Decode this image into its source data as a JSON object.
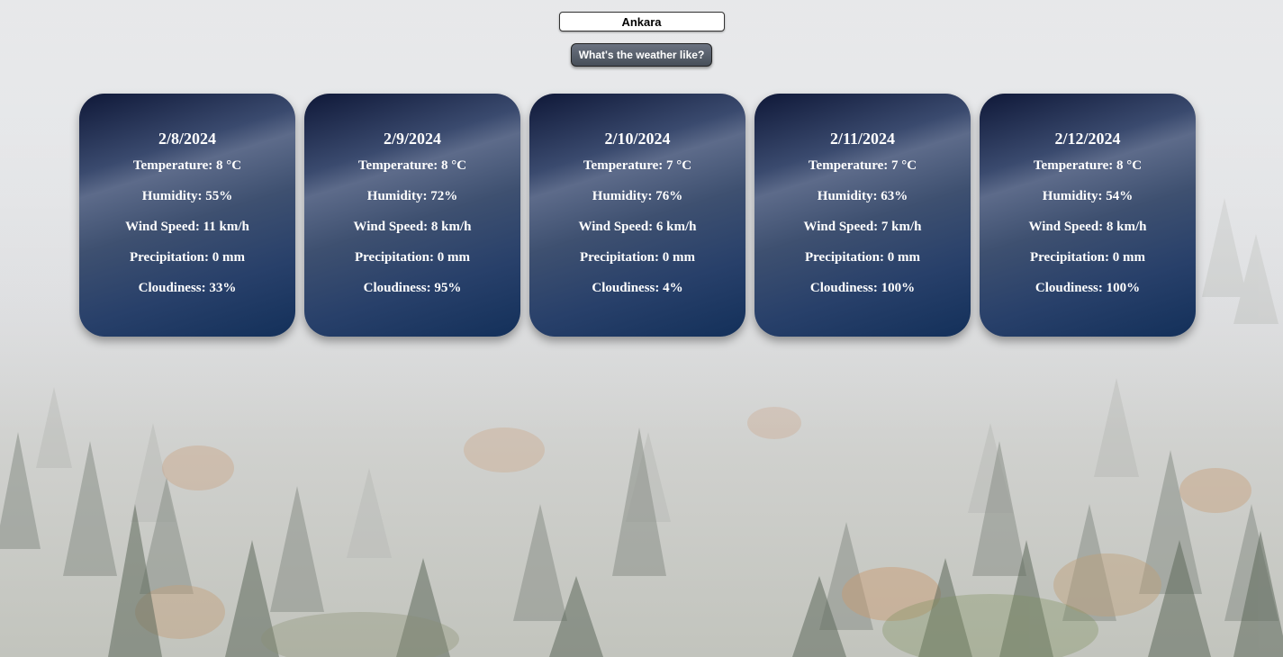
{
  "search": {
    "city_value": "Ankara",
    "button_label": "What's the weather like?"
  },
  "forecast": [
    {
      "date": "2/8/2024",
      "temperature": "Temperature: 8 °C",
      "humidity": "Humidity: 55%",
      "wind": "Wind Speed: 11 km/h",
      "precipitation": "Precipitation: 0 mm",
      "cloudiness": "Cloudiness: 33%"
    },
    {
      "date": "2/9/2024",
      "temperature": "Temperature: 8 °C",
      "humidity": "Humidity: 72%",
      "wind": "Wind Speed: 8 km/h",
      "precipitation": "Precipitation: 0 mm",
      "cloudiness": "Cloudiness: 95%"
    },
    {
      "date": "2/10/2024",
      "temperature": "Temperature: 7 °C",
      "humidity": "Humidity: 76%",
      "wind": "Wind Speed: 6 km/h",
      "precipitation": "Precipitation: 0 mm",
      "cloudiness": "Cloudiness: 4%"
    },
    {
      "date": "2/11/2024",
      "temperature": "Temperature: 7 °C",
      "humidity": "Humidity: 63%",
      "wind": "Wind Speed: 7 km/h",
      "precipitation": "Precipitation: 0 mm",
      "cloudiness": "Cloudiness: 100%"
    },
    {
      "date": "2/12/2024",
      "temperature": "Temperature: 8 °C",
      "humidity": "Humidity: 54%",
      "wind": "Wind Speed: 8 km/h",
      "precipitation": "Precipitation: 0 mm",
      "cloudiness": "Cloudiness: 100%"
    }
  ],
  "colors": {
    "card_top": "#0f1838",
    "card_bottom": "#13305a",
    "button_bg": "#474f59",
    "text": "#ffffff"
  }
}
